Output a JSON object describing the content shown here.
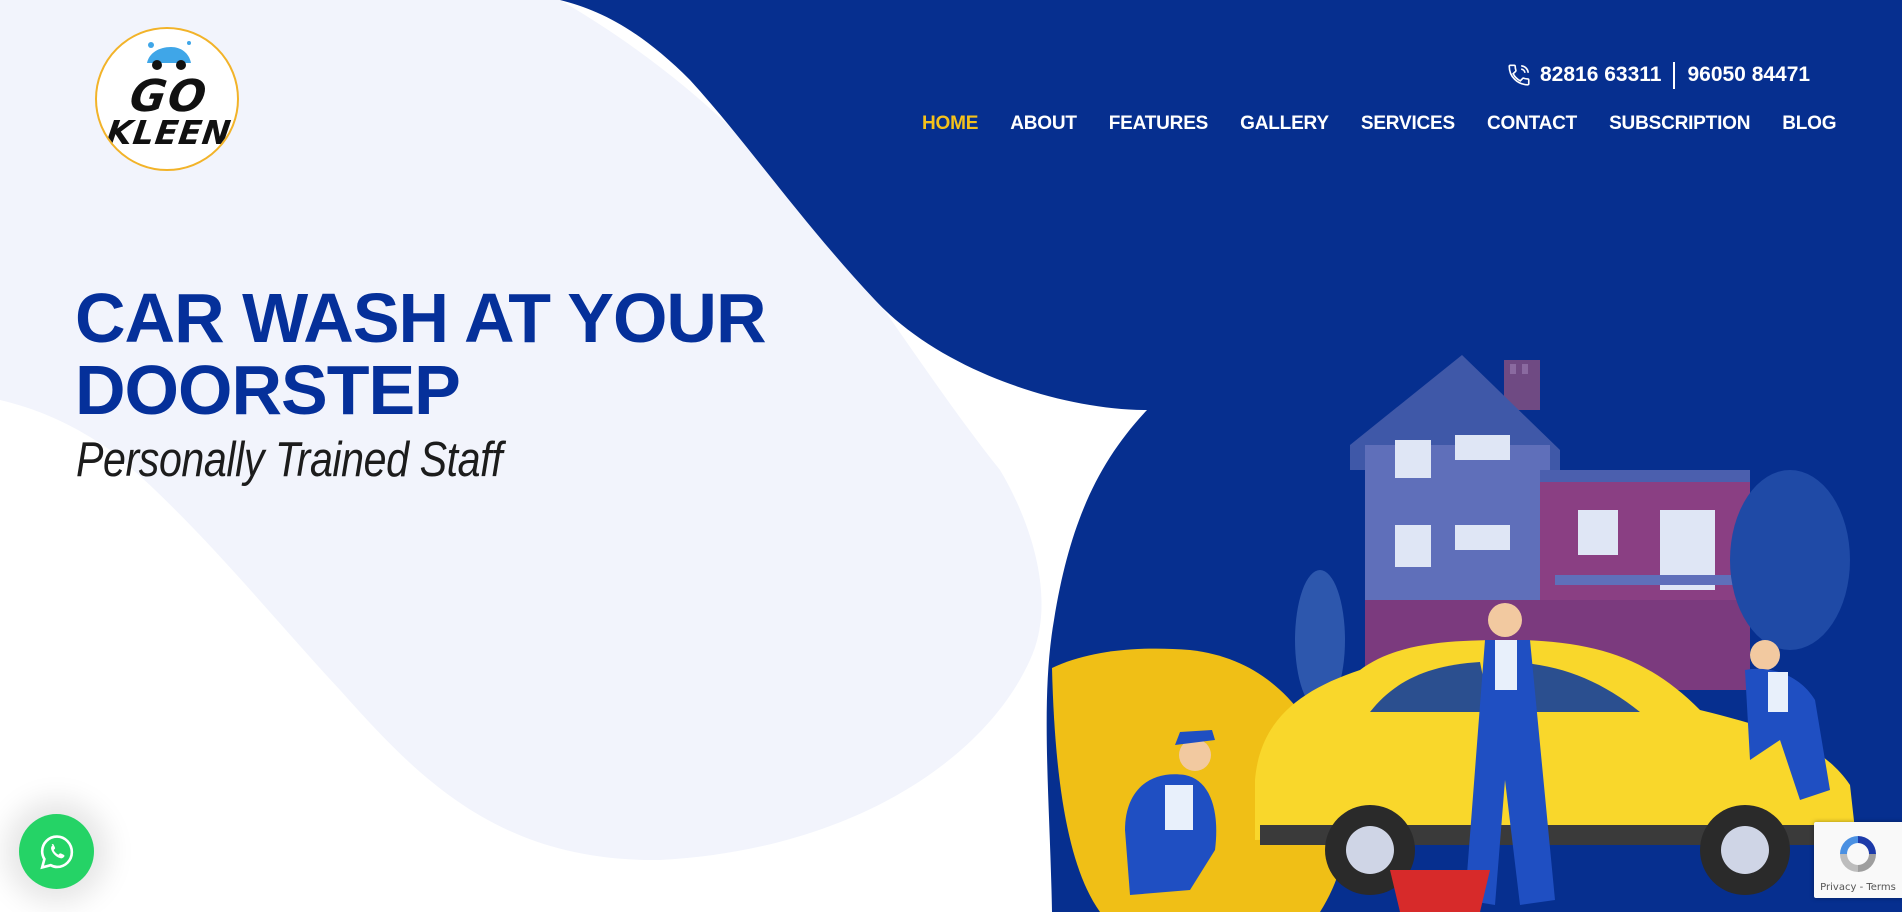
{
  "brand": {
    "logo_line1": "GO",
    "logo_line2": "KLEEN",
    "accent_yellow": "#f4c11b",
    "primary_blue": "#05309a"
  },
  "contact": {
    "phone_icon": "phone-icon",
    "phone1": "82816 63311",
    "phone2": "96050 84471"
  },
  "nav": {
    "items": [
      {
        "label": "HOME",
        "active": true
      },
      {
        "label": "ABOUT"
      },
      {
        "label": "FEATURES"
      },
      {
        "label": "GALLERY"
      },
      {
        "label": "SERVICES"
      },
      {
        "label": "CONTACT"
      },
      {
        "label": "SUBSCRIPTION"
      },
      {
        "label": "BLOG"
      }
    ]
  },
  "hero": {
    "title_line1": "CAR WASH AT YOUR",
    "title_line2": "DOORSTEP",
    "subtitle": "Personally Trained Staff"
  },
  "widgets": {
    "whatsapp_icon": "whatsapp-icon",
    "recaptcha_icon": "recaptcha-icon",
    "recaptcha_privacy": "Privacy",
    "recaptcha_sep": " - ",
    "recaptcha_terms": "Terms"
  }
}
